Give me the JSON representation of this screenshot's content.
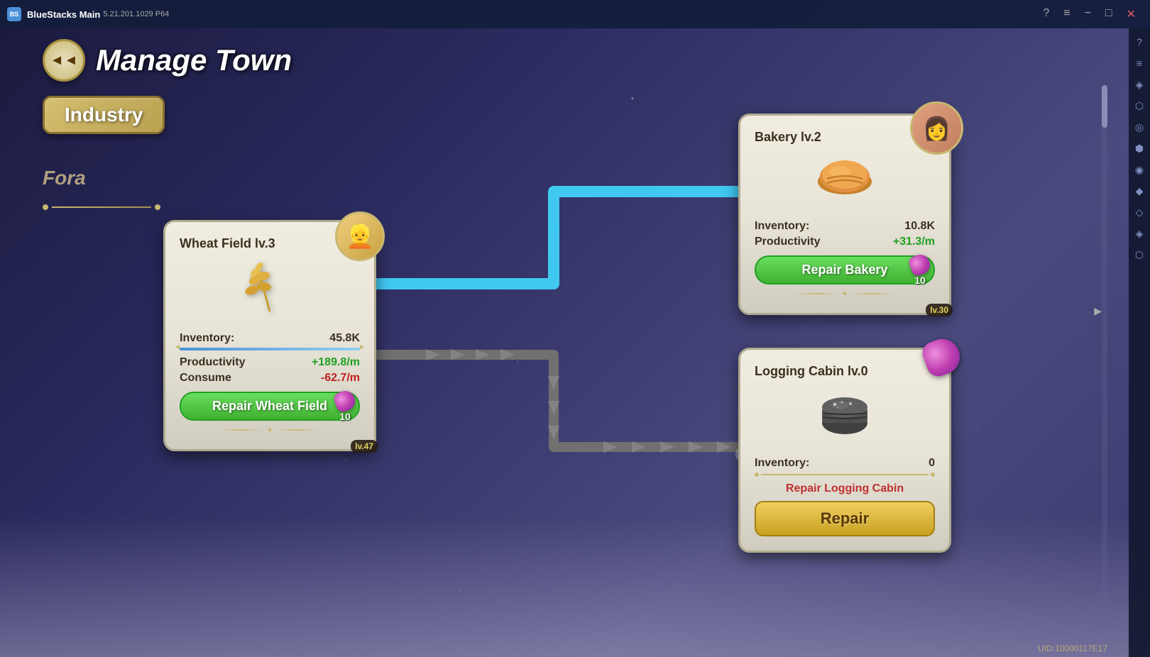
{
  "titlebar": {
    "logo_text": "BS",
    "app_name": "BlueStacks Main",
    "subtitle": "5.21.201.1029 P64",
    "controls": [
      "minimize",
      "restore",
      "close"
    ]
  },
  "page": {
    "title": "Manage Town",
    "back_label": "◄◄"
  },
  "tabs": {
    "industry_label": "Industry"
  },
  "fora": {
    "label": "Fora"
  },
  "wheat_field": {
    "title": "Wheat Field lv.3",
    "character_level": "lv.47",
    "inventory_label": "Inventory:",
    "inventory_value": "45.8K",
    "productivity_label": "Productivity",
    "productivity_value": "+189.8/m",
    "consume_label": "Consume",
    "consume_value": "-62.7/m",
    "repair_label": "Repair Wheat Field",
    "repair_cost": "10"
  },
  "bakery": {
    "title": "Bakery lv.2",
    "character_level": "lv.30",
    "inventory_label": "Inventory:",
    "inventory_value": "10.8K",
    "productivity_label": "Productivity",
    "productivity_value": "+31.3/m",
    "repair_label": "Repair Bakery",
    "repair_cost": "10"
  },
  "logging_cabin": {
    "title": "Logging Cabin lv.0",
    "inventory_label": "Inventory:",
    "inventory_value": "0",
    "repair_label": "Repair Logging Cabin",
    "repair_button_label": "Repair"
  },
  "sidebar_icons": [
    "?",
    "≡",
    "◈",
    "⬡",
    "◎",
    "⬢",
    "◉",
    "◆",
    "◇",
    "◈",
    "⬡"
  ],
  "footer": {
    "uid": "UID:10000117E17"
  }
}
